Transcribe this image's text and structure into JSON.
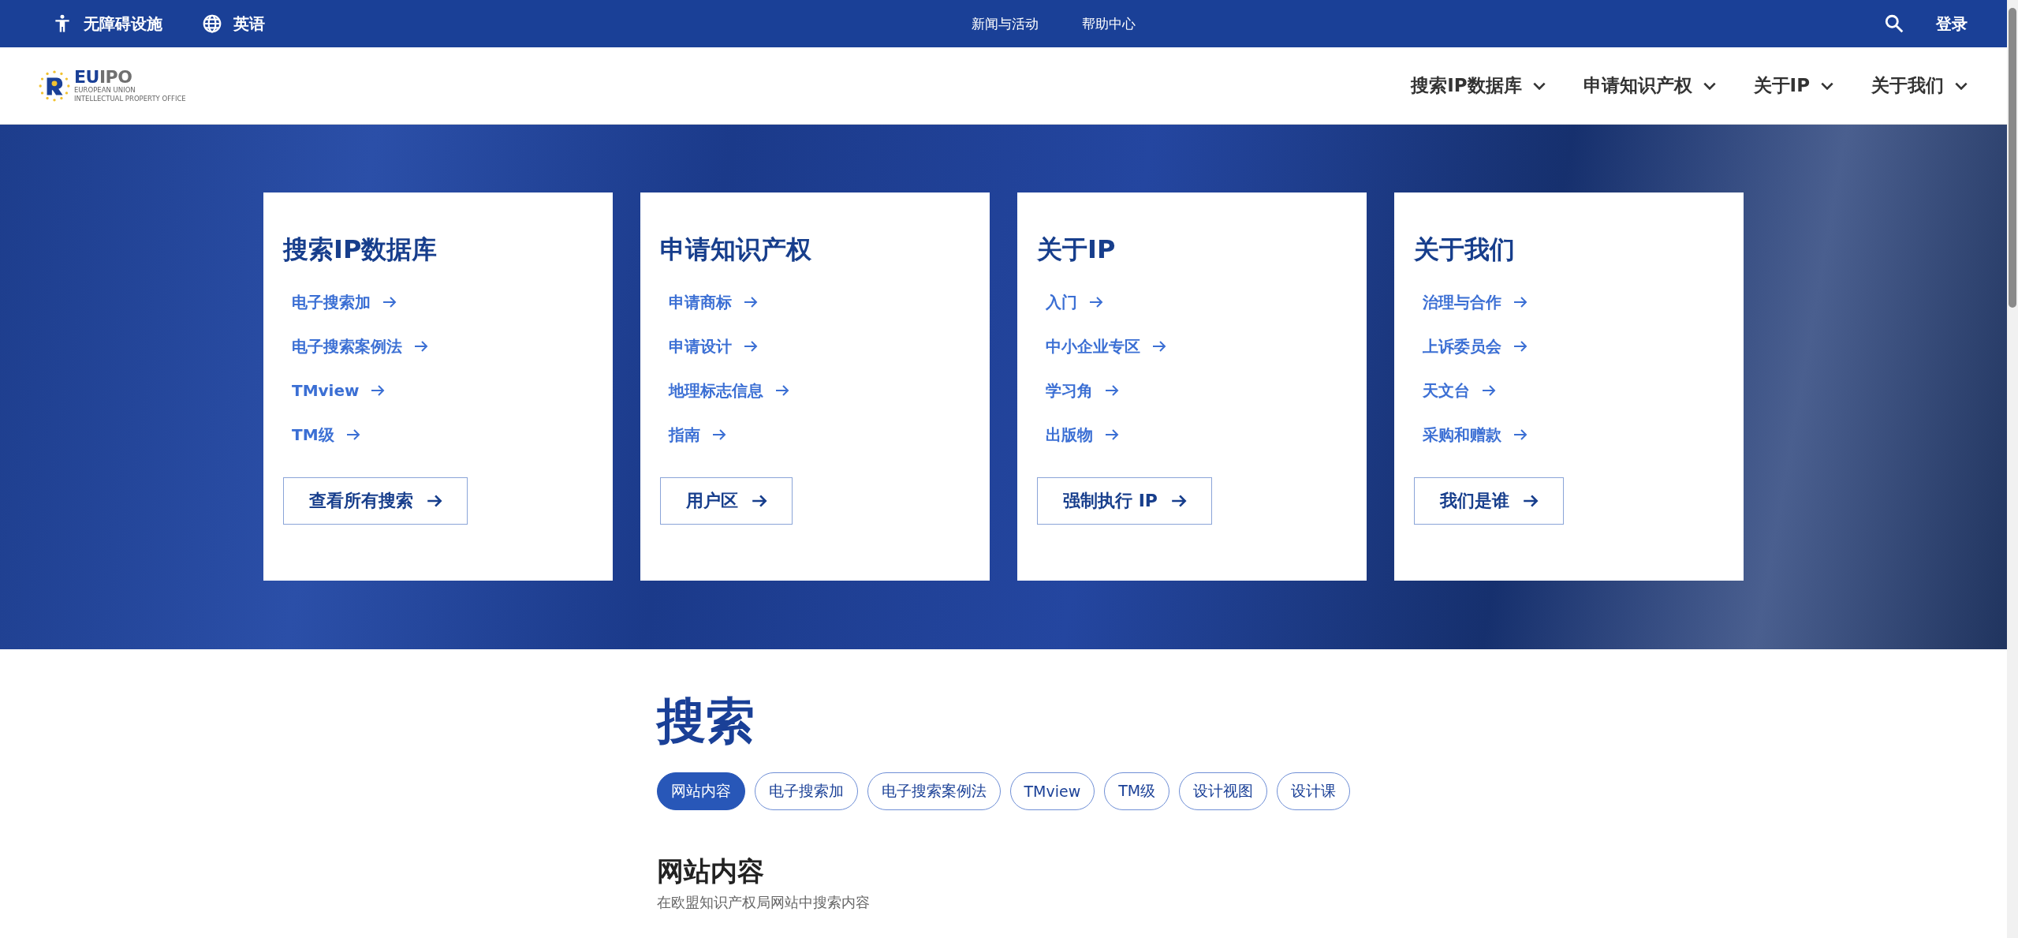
{
  "top_bar": {
    "accessibility": "无障碍设施",
    "language": "英语",
    "links": [
      "新闻与活动",
      "帮助中心"
    ],
    "login": "登录"
  },
  "logo": {
    "wordmark_blue": "EU",
    "wordmark_grey": "IPO",
    "line_1": "EUROPEAN UNION",
    "line_2": "INTELLECTUAL PROPERTY OFFICE"
  },
  "main_nav": [
    {
      "label": "搜索IP数据库"
    },
    {
      "label": "申请知识产权"
    },
    {
      "label": "关于IP"
    },
    {
      "label": "关于我们"
    }
  ],
  "cards": [
    {
      "title": "搜索IP数据库",
      "links": [
        "电子搜索加",
        "电子搜索案例法",
        "TMview",
        "TM级"
      ],
      "button": "查看所有搜索"
    },
    {
      "title": "申请知识产权",
      "links": [
        "申请商标",
        "申请设计",
        "地理标志信息",
        "指南"
      ],
      "button": "用户区"
    },
    {
      "title": "关于IP",
      "links": [
        "入门",
        "中小企业专区",
        "学习角",
        "出版物"
      ],
      "button": "强制执行 IP"
    },
    {
      "title": "关于我们",
      "links": [
        "治理与合作",
        "上诉委员会",
        "天文台",
        "采购和赠款"
      ],
      "button": "我们是谁"
    }
  ],
  "search": {
    "title": "搜索",
    "filters": [
      {
        "label": "网站内容",
        "selected": true
      },
      {
        "label": "电子搜索加",
        "selected": false
      },
      {
        "label": "电子搜索案例法",
        "selected": false
      },
      {
        "label": "TMview",
        "selected": false
      },
      {
        "label": "TM级",
        "selected": false
      },
      {
        "label": "设计视图",
        "selected": false
      },
      {
        "label": "设计课",
        "selected": false
      }
    ],
    "section_title": "网站内容",
    "description": "在欧盟知识产权局网站中搜索内容"
  }
}
